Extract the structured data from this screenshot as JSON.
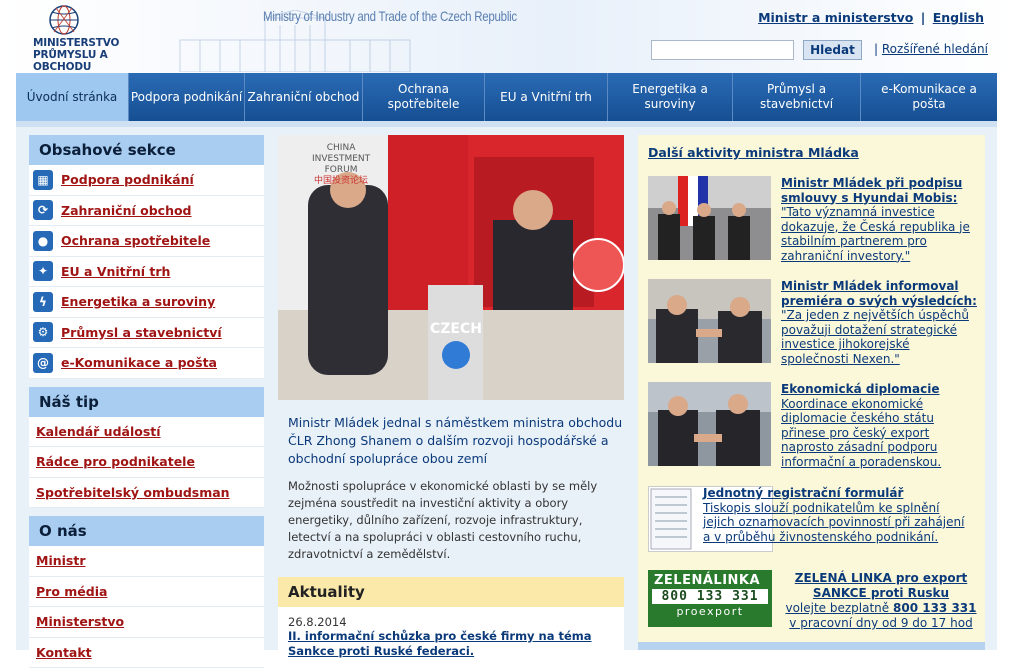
{
  "header": {
    "logo_line1": "MINISTERSTVO",
    "logo_line2": "PRŮMYSLU A OBCHODU",
    "ministry_title": "Ministry of Industry and Trade of the Czech Republic",
    "toplink_ministr": "Ministr a ministerstvo",
    "toplink_sep": "|",
    "toplink_english": "English",
    "search_value": "",
    "search_button": "Hledat",
    "adv_search_sep": "|",
    "adv_search": "Rozšířené hledání"
  },
  "nav": [
    {
      "label": "Úvodní stránka",
      "active": true
    },
    {
      "label": "Podpora podnikání"
    },
    {
      "label": "Zahraniční obchod"
    },
    {
      "label": "Ochrana spotřebitele"
    },
    {
      "label": "EU a Vnitřní trh"
    },
    {
      "label": "Energetika a suroviny"
    },
    {
      "label": "Průmysl a stavebnictví"
    },
    {
      "label": "e-Komunikace a pošta"
    }
  ],
  "left": {
    "sections_title": "Obsahové sekce",
    "sections": [
      {
        "label": "Podpora podnikání",
        "icon": "grid-icon"
      },
      {
        "label": "Zahraniční obchod",
        "icon": "refresh-icon"
      },
      {
        "label": "Ochrana spotřebitele",
        "icon": "person-icon"
      },
      {
        "label": "EU a Vnitřní trh",
        "icon": "stars-icon"
      },
      {
        "label": "Energetika a suroviny",
        "icon": "lightning-icon"
      },
      {
        "label": "Průmysl a stavebnictví",
        "icon": "gear-icon"
      },
      {
        "label": "e-Komunikace a pošta",
        "icon": "at-icon"
      }
    ],
    "tip_title": "Náš tip",
    "tips": [
      "Kalendář událostí",
      "Rádce pro podnikatele",
      "Spotřebitelský ombudsman"
    ],
    "about_title": "O nás",
    "about": [
      "Ministr",
      "Pro média",
      "Ministerstvo",
      "Kontakt"
    ]
  },
  "main": {
    "hero_sign1": "CHINA",
    "hero_sign2": "INVESTMENT",
    "hero_sign3": "FORUM",
    "hero_sign4": "中国投资论坛",
    "hero_screen": "CZECH",
    "article_title": "Ministr Mládek jednal s náměstkem ministra obchodu ČLR Zhong Shanem o dalším rozvoji hospodářské a obchodní spolupráce obou zemí",
    "article_body": "Možnosti spolupráce v ekonomické oblasti by se měly zejména soustředit na investiční aktivity a obory energetiky, důlního zařízení, rozvoje infrastruktury, letectví a na spolupráci v oblasti cestovního ruchu, zdravotnictví a zemědělství.",
    "aktuality_title": "Aktuality",
    "aktuality": [
      {
        "date": "26.8.2014",
        "title": "II. informační schůzka pro české firmy na téma Sankce proti Ruské federaci."
      }
    ]
  },
  "right": {
    "title": "Další aktivity ministra Mládka",
    "news": [
      {
        "title": "Ministr Mládek při podpisu smlouvy s Hyundai Mobis:",
        "text": "\"Tato významná investice dokazuje, že Česká republika je stabilním partnerem pro zahraniční investory.\""
      },
      {
        "title": "Ministr Mládek informoval premiéra o svých výsledcích:",
        "text": "\"Za jeden z největších úspěchů považuji dotažení strategické investice jihokorejské společnosti Nexen.\""
      },
      {
        "title": "Ekonomická diplomacie",
        "text": "Koordinace ekonomické diplomacie českého státu přinese pro český export naprosto zásadní podporu informační a poradenskou."
      },
      {
        "title": "Jednotný registrační formulář",
        "text": "Tiskopis slouží podnikatelům ke splnění jejich oznamovacích povinností při zahájení a v průběhu živnostenského podnikání."
      }
    ],
    "green_word": "ZELENÁLINKA",
    "green_number": "800 133 331",
    "green_sub": "proexport",
    "green_title1": "ZELENÁ LINKA pro export",
    "green_title2": "SANKCE proti Rusku",
    "green_line1": "volejte bezplatně",
    "green_num_bold": "800 133 331",
    "green_line2": "v pracovní dny od 9 do 17 hod"
  }
}
